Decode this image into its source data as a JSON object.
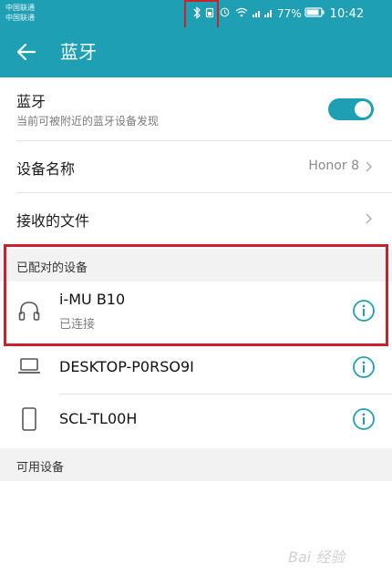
{
  "statusbar": {
    "carrier_line1": "中国联通",
    "carrier_line2": "中国联通",
    "battery": "77%",
    "time": "10:42",
    "icons": [
      "bluetooth-icon",
      "battery-saver-icon",
      "wifi-icon",
      "signal-icon",
      "battery-icon"
    ]
  },
  "appbar": {
    "title": "蓝牙",
    "back_icon": "arrow-left-icon"
  },
  "bluetooth": {
    "label": "蓝牙",
    "subtitle": "当前可被附近的蓝牙设备发现",
    "toggle_on": true
  },
  "device_name": {
    "label": "设备名称",
    "value": "Honor 8"
  },
  "received_files": {
    "label": "接收的文件"
  },
  "paired_section": {
    "title": "已配对的设备",
    "devices": [
      {
        "name": "i-MU B10",
        "status": "已连接",
        "icon": "headphones-icon"
      },
      {
        "name": "DESKTOP-P0RSO9I",
        "status": "",
        "icon": "laptop-icon"
      },
      {
        "name": "SCL-TL00H",
        "status": "",
        "icon": "phone-icon"
      }
    ]
  },
  "available_section": {
    "title": "可用设备"
  },
  "watermark": "Bai 经验",
  "colors": {
    "accent": "#1f9fb4",
    "highlight_box": "#c8232c"
  }
}
